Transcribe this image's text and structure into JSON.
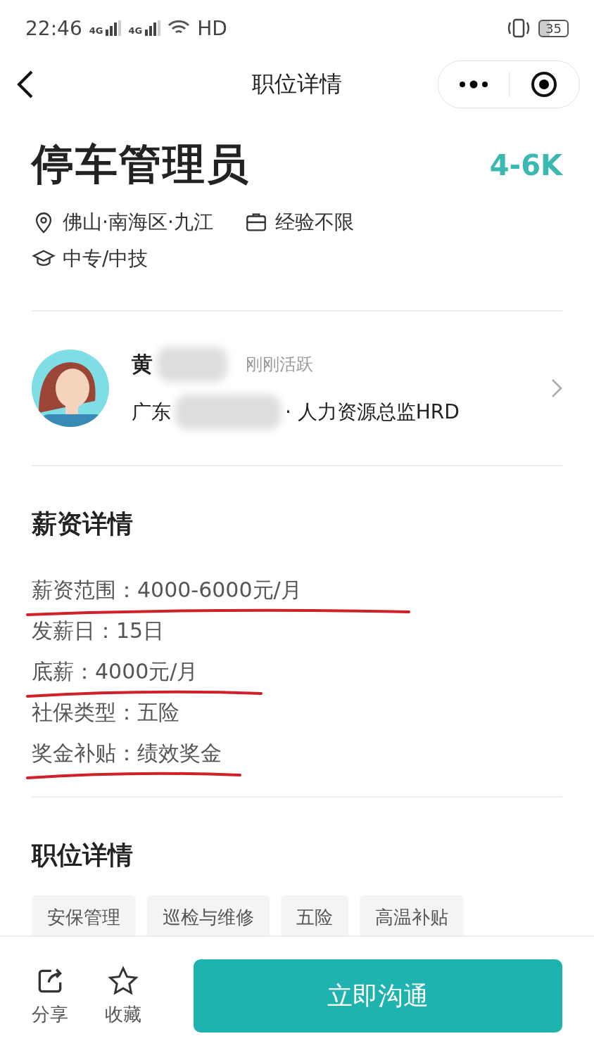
{
  "status_bar": {
    "time": "22:46",
    "network_1": "4G",
    "network_2": "4G",
    "hd": "HD",
    "battery": "35"
  },
  "nav": {
    "title": "职位详情"
  },
  "job": {
    "title": "停车管理员",
    "salary": "4-6K",
    "location": "佛山·南海区·九江",
    "experience": "经验不限",
    "education": "中专/中技"
  },
  "recruiter": {
    "name": "黄",
    "status": "刚刚活跃",
    "company": "广东",
    "role": "· 人力资源总监HRD"
  },
  "salary_section": {
    "heading": "薪资详情",
    "rows": [
      {
        "label": "薪资范围：",
        "value": "4000-6000元/月",
        "underlined": true
      },
      {
        "label": "发薪日：",
        "value": "15日",
        "underlined": false
      },
      {
        "label": "底薪：",
        "value": "4000元/月",
        "underlined": true
      },
      {
        "label": "社保类型：",
        "value": "五险",
        "underlined": false
      },
      {
        "label": "奖金补贴：",
        "value": "绩效奖金",
        "underlined": true
      }
    ]
  },
  "job_section": {
    "heading": "职位详情",
    "tags": [
      "安保管理",
      "巡检与维修",
      "五险",
      "高温补贴"
    ]
  },
  "bottom_bar": {
    "share": "分享",
    "favorite": "收藏",
    "chat_button": "立即沟通"
  }
}
